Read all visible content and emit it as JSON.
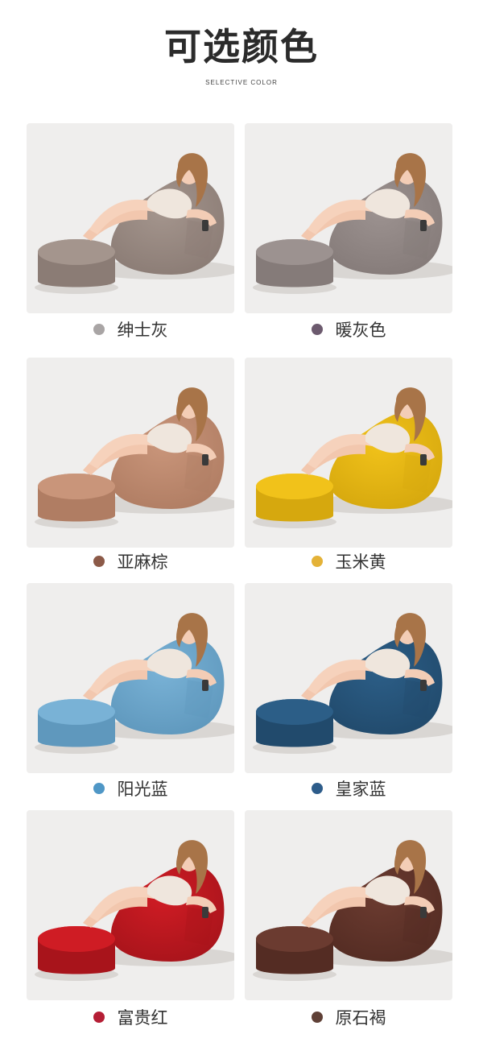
{
  "header": {
    "title": "可选颜色",
    "subtitle": "SELECTIVE COLOR"
  },
  "colors": [
    {
      "label": "绅士灰",
      "dot": "#a9a5a5",
      "fabric": "#a4958d",
      "shade": "#8b7c75"
    },
    {
      "label": "暖灰色",
      "dot": "#6c5a6e",
      "fabric": "#9c9290",
      "shade": "#857b79"
    },
    {
      "label": "亚麻棕",
      "dot": "#8c5a48",
      "fabric": "#c9957a",
      "shade": "#b07d63"
    },
    {
      "label": "玉米黄",
      "dot": "#e4b237",
      "fabric": "#f1c21a",
      "shade": "#d6a80e"
    },
    {
      "label": "阳光蓝",
      "dot": "#4f97c6",
      "fabric": "#79b2d6",
      "shade": "#5f98bd"
    },
    {
      "label": "皇家蓝",
      "dot": "#2d5c8a",
      "fabric": "#2c5e87",
      "shade": "#214a6c"
    },
    {
      "label": "富贵红",
      "dot": "#b51e35",
      "fabric": "#cf1c24",
      "shade": "#a8141b"
    },
    {
      "label": "原石褐",
      "dot": "#5f4036",
      "fabric": "#6b3b30",
      "shade": "#542c23"
    }
  ]
}
